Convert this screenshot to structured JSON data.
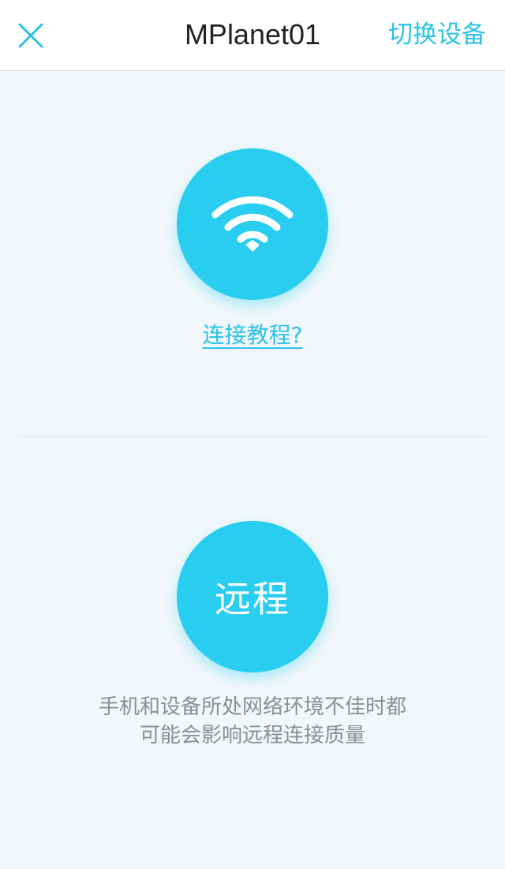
{
  "header": {
    "close_icon": "close-icon",
    "title": "MPlanet01",
    "switch_device_label": "切换设备"
  },
  "wifi_button": {
    "icon": "wifi-icon"
  },
  "tutorial_link": "连接教程?",
  "remote_button": {
    "label": "远程"
  },
  "hint": {
    "line1": "手机和设备所处网络环境不佳时都",
    "line2": "可能会影响远程连接质量"
  },
  "colors": {
    "accent": "#28cdf0",
    "link": "#2ac2e8",
    "background": "#f1f7fa",
    "hint_text": "#8a8f93"
  }
}
